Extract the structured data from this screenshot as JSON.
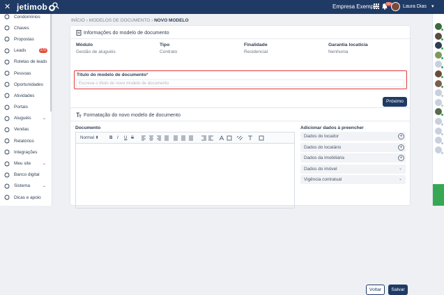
{
  "topbar": {
    "close": "✕",
    "logo": "jetimob",
    "company": "Empresa Exemplo",
    "notif_count": "99+",
    "user": "Laura Dias",
    "caret": "▾"
  },
  "sidebar": {
    "items": [
      {
        "label": "Condomínios",
        "icon": "building-icon"
      },
      {
        "label": "Chaves",
        "icon": "key-icon"
      },
      {
        "label": "Propostas",
        "icon": "gavel-icon"
      },
      {
        "label": "Leads",
        "icon": "leads-icon",
        "count": "270"
      },
      {
        "label": "Roletas de leads",
        "icon": "roulette-icon"
      },
      {
        "label": "Pessoas",
        "icon": "people-icon"
      },
      {
        "label": "Oportunidades",
        "icon": "target-icon"
      },
      {
        "label": "Atividades",
        "icon": "check-icon"
      },
      {
        "label": "Portais",
        "icon": "megaphone-icon"
      },
      {
        "label": "Aluguéis",
        "icon": "handshake-icon",
        "chevron": "⌄"
      },
      {
        "label": "Vendas",
        "icon": "sales-icon"
      },
      {
        "label": "Relatórios",
        "icon": "report-icon"
      },
      {
        "label": "Integrações",
        "icon": "plug-icon"
      },
      {
        "label": "Meu site",
        "icon": "globe-icon",
        "chevron": "⌄"
      },
      {
        "label": "Banco digital",
        "icon": "bank-icon"
      },
      {
        "label": "Sistema",
        "icon": "laptop-icon",
        "chevron": "⌄"
      },
      {
        "label": "Dicas e apoio",
        "icon": "info-icon"
      }
    ]
  },
  "breadcrumb": {
    "home": "INÍCIO",
    "sep": "›",
    "parent": "MODELOS DE DOCUMENTO",
    "current": "NOVO MODELO"
  },
  "info_card": {
    "title": "Informações do modelo de documento",
    "columns": [
      {
        "header": "Módulo",
        "value": "Gestão de aluguéis"
      },
      {
        "header": "Tipo",
        "value": "Contrato"
      },
      {
        "header": "Finalidade",
        "value": "Residencial"
      },
      {
        "header": "Garantia locatícia",
        "value": "Nenhuma"
      }
    ],
    "title_field_label": "Título do modelo de documento",
    "required_mark": "*",
    "title_field_placeholder": "Escreva o título do novo modelo de documento",
    "next_button": "Próximo"
  },
  "format_card": {
    "title": "Formatação do novo modelo de documento",
    "doc_label": "Documento",
    "toolbar": {
      "style_select": "Normal",
      "bold": "B",
      "italic": "I",
      "underline": "U",
      "strike": "S"
    },
    "add_label": "Adicionar dados à preencher",
    "add_items": [
      {
        "label": "Dados do locador",
        "kind": "plus"
      },
      {
        "label": "Dados do locatário",
        "kind": "plus"
      },
      {
        "label": "Dados da imobiliária",
        "kind": "plus"
      },
      {
        "label": "Dados do imóvel",
        "kind": "chevron"
      },
      {
        "label": "Vigência contratual",
        "kind": "chevron"
      }
    ],
    "voltar_button": "Voltar",
    "salvar_button": "Salvar"
  },
  "colors": {
    "navy": "#1f3a64",
    "danger": "#e03a3a",
    "online": "#36a853"
  }
}
